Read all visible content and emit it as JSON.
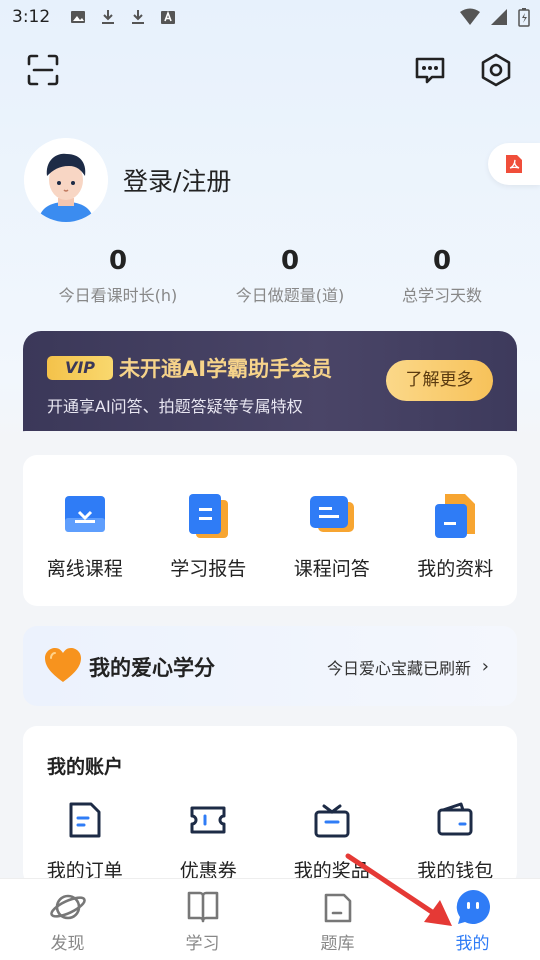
{
  "status_bar": {
    "time": "3:12"
  },
  "profile": {
    "login_label": "登录/注册"
  },
  "stats": [
    {
      "value": "0",
      "label": "今日看课时长(h)"
    },
    {
      "value": "0",
      "label": "今日做题量(道)"
    },
    {
      "value": "0",
      "label": "总学习天数"
    }
  ],
  "vip": {
    "badge": "VIP",
    "title": "未开通AI学霸助手会员",
    "subtitle": "开通享AI问答、拍题答疑等专属特权",
    "button": "了解更多"
  },
  "tools": [
    {
      "label": "离线课程",
      "icon": "offline-course-icon"
    },
    {
      "label": "学习报告",
      "icon": "study-report-icon"
    },
    {
      "label": "课程问答",
      "icon": "course-qa-icon"
    },
    {
      "label": "我的资料",
      "icon": "my-materials-icon"
    }
  ],
  "love_credit": {
    "title": "我的爱心学分",
    "status": "今日爱心宝藏已刷新",
    "chevron": "›"
  },
  "account": {
    "title": "我的账户",
    "items": [
      {
        "label": "我的订单",
        "icon": "order-icon"
      },
      {
        "label": "优惠券",
        "icon": "coupon-icon"
      },
      {
        "label": "我的奖品",
        "icon": "prize-icon"
      },
      {
        "label": "我的钱包",
        "icon": "wallet-icon"
      }
    ]
  },
  "tabbar": [
    {
      "label": "发现",
      "icon": "planet-icon",
      "active": false
    },
    {
      "label": "学习",
      "icon": "book-icon",
      "active": false
    },
    {
      "label": "题库",
      "icon": "question-bank-icon",
      "active": false
    },
    {
      "label": "我的",
      "icon": "chat-bubble-icon",
      "active": true
    }
  ],
  "colors": {
    "accent": "#2f7cf6",
    "vip_gold": "#f6d38a",
    "vip_bg": "#3b3859",
    "heart": "#f7931e"
  }
}
